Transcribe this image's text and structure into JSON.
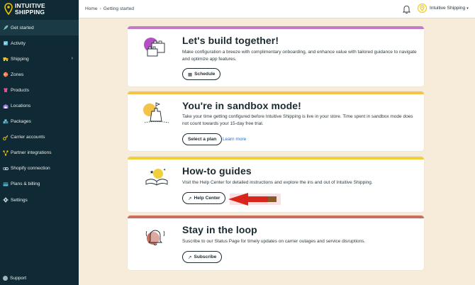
{
  "brand": {
    "name_line1": "INTUITIVE",
    "name_line2": "SHIPPING",
    "accent": "#f2c400"
  },
  "sidebar": {
    "items": [
      {
        "label": "Get started",
        "icon": "rocket-icon",
        "active": true
      },
      {
        "label": "Activity",
        "icon": "activity-icon"
      },
      {
        "label": "Shipping",
        "icon": "truck-icon",
        "has_submenu": true
      },
      {
        "label": "Zones",
        "icon": "globe-icon"
      },
      {
        "label": "Products",
        "icon": "shirt-icon"
      },
      {
        "label": "Locations",
        "icon": "warehouse-icon"
      },
      {
        "label": "Packages",
        "icon": "package-icon"
      },
      {
        "label": "Carrier accounts",
        "icon": "key-icon"
      },
      {
        "label": "Partner integrations",
        "icon": "network-icon"
      },
      {
        "label": "Shopify connection",
        "icon": "link-icon"
      },
      {
        "label": "Plans & billing",
        "icon": "billing-icon"
      },
      {
        "label": "Settings",
        "icon": "gear-icon"
      }
    ],
    "support_label": "Support"
  },
  "topbar": {
    "breadcrumb": [
      "Home",
      "Getting started"
    ],
    "account_name": "Intuitive Shipping"
  },
  "cards": [
    {
      "title": "Let's build together!",
      "description": "Make configuration a breeze with complimentary onboarding, and enhance value with tailored guidance to navigate and optimize app features.",
      "button_label": "Schedule",
      "stripe_color": "#c678c9"
    },
    {
      "title": "You're in sandbox mode!",
      "description": "Take your time getting configured before Intuitive Shipping is live in your store. Time spent in sandbox mode does not count towards your 15-day free trial.",
      "button_label": "Select a plan",
      "link_label": "Learn more",
      "stripe_color": "#f5c24a"
    },
    {
      "title": "How-to guides",
      "description": "Visit the Help Center for detailed instructions and explore the ins and out of Intuitive Shipping.",
      "button_label": "Help Center",
      "stripe_color": "#f1cf3c"
    },
    {
      "title": "Stay in the loop",
      "description": "Suscribe to our Status Page for timely updates on carrier outages and service disruptions.",
      "button_label": "Subscribe",
      "stripe_color": "#c96f5e"
    }
  ]
}
